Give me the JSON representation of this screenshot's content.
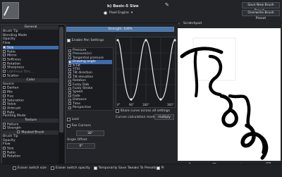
{
  "header": {
    "preset_name": "b) Basic-5 Size",
    "engine_label": "Pixel Engine",
    "engine_dropdown": "▾",
    "save_new_button": "Save New Brush Preset...",
    "overwrite_button": "Overwrite Brush Preset"
  },
  "options": {
    "sections": {
      "general": "General",
      "color": "Color",
      "texture": "Texture",
      "masked": "Masked Brush"
    },
    "general_items": [
      {
        "label": "Brush Tip",
        "checkbox": false,
        "checked": false
      },
      {
        "label": "Blending Mode",
        "checkbox": false,
        "checked": false
      },
      {
        "label": "Opacity",
        "checkbox": false,
        "checked": false
      },
      {
        "label": "Flow",
        "checkbox": false,
        "checked": false
      },
      {
        "label": "Size",
        "checkbox": true,
        "checked": true,
        "selected": true
      },
      {
        "label": "Ratio",
        "checkbox": true,
        "checked": false
      },
      {
        "label": "Mirror",
        "checkbox": true,
        "checked": false
      },
      {
        "label": "Softness",
        "checkbox": true,
        "checked": false
      },
      {
        "label": "Rotation",
        "checkbox": true,
        "checked": false
      },
      {
        "label": "Sharpness",
        "checkbox": true,
        "checked": false
      },
      {
        "label": "Lightness Stre...",
        "checkbox": true,
        "checked": false,
        "dim": true
      },
      {
        "label": "Scatter",
        "checkbox": true,
        "checked": false
      }
    ],
    "color_items": [
      {
        "label": "Source",
        "checkbox": false
      },
      {
        "label": "Darken",
        "checkbox": true
      },
      {
        "label": "Mix",
        "checkbox": true
      },
      {
        "label": "Hue",
        "checkbox": true
      },
      {
        "label": "Saturation",
        "checkbox": true
      },
      {
        "label": "Value",
        "checkbox": true
      },
      {
        "label": "Airbrush",
        "checkbox": true
      },
      {
        "label": "Rate",
        "checkbox": true
      },
      {
        "label": "Painting Mode",
        "checkbox": false
      }
    ],
    "texture_items": [
      {
        "label": "Pattern",
        "checkbox": true
      },
      {
        "label": "Strength",
        "checkbox": true
      }
    ],
    "masked_items": [
      {
        "label": "Brush Tip",
        "checkbox": false
      },
      {
        "label": "Opacity",
        "checkbox": false
      },
      {
        "label": "Flow",
        "checkbox": false
      },
      {
        "label": "Size",
        "checkbox": true
      },
      {
        "label": "Ratio",
        "checkbox": true
      },
      {
        "label": "Rotation",
        "checkbox": true
      }
    ]
  },
  "settings": {
    "strength": "Strength: 100%",
    "enable_pen_settings": "Enable Pen Settings",
    "sensors": [
      {
        "label": "Pressure",
        "selected": false
      },
      {
        "label": "Pressure(in)",
        "selected": false
      },
      {
        "label": "Tangential pressure",
        "selected": false
      },
      {
        "label": "Drawing angle",
        "selected": true
      },
      {
        "label": "X-Tilt",
        "selected": false
      },
      {
        "label": "Y-Tilt",
        "selected": false
      },
      {
        "label": "Tilt direction",
        "selected": false
      },
      {
        "label": "Tilt elevation",
        "selected": false
      },
      {
        "label": "Rotation",
        "selected": false
      },
      {
        "label": "Fuzzy Dab",
        "selected": false
      },
      {
        "label": "Fuzzy Stroke",
        "selected": false
      },
      {
        "label": "Speed",
        "selected": false
      },
      {
        "label": "Fade",
        "selected": false
      },
      {
        "label": "Distance",
        "selected": false
      },
      {
        "label": "Time",
        "selected": false
      },
      {
        "label": "Perspective",
        "selected": false
      }
    ],
    "curve_min": "0°",
    "curve_mid": "90°",
    "curve_mid2": "180°",
    "curve_max": "360°",
    "share_curve": "Share curve across all settings",
    "curves_calc_label": "Curves calculation mode:",
    "curves_calc_value": "multiply",
    "lock": "Lock",
    "fan_corners": "Fan Corners",
    "fan_angle": "30°",
    "angle_offset_label": "Angle Offset",
    "angle_offset": "0°"
  },
  "scratchpad": {
    "title": "Scratchpad",
    "tools": [
      "brush-icon",
      "fill-icon",
      "bucket-icon",
      "clear-icon"
    ]
  },
  "footer": {
    "eraser_size": "Eraser switch size",
    "eraser_opacity": "Eraser switch opacity",
    "temp_save": "Temporarily Save Tweaks To Presets",
    "instant_preview": "Instant Preview",
    "instant_preview_short": "Pr",
    "hide_button": "Hide Scratchpad",
    "ok_button": "OK"
  },
  "colors": {
    "accent": "#3d6bb0",
    "strength_bar": "#4a76a8",
    "canvas": "#ffffff"
  }
}
